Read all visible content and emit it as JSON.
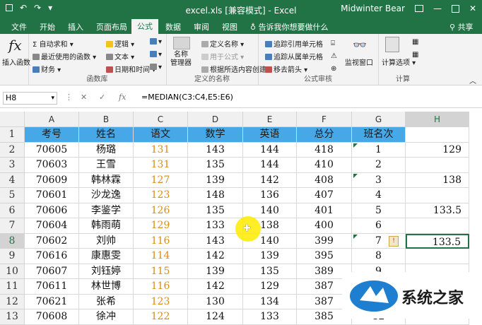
{
  "titlebar": {
    "filename": "excel.xls",
    "mode": "[兼容模式]",
    "sep": "-",
    "app": "Excel",
    "user": "Midwinter Bear",
    "save_icon": "save-icon",
    "undo_icon": "undo-icon",
    "redo_icon": "redo-icon",
    "minimize_icon": "minimize-icon",
    "maximize_icon": "maximize-icon",
    "close_icon": "close-icon"
  },
  "tabs": [
    "文件",
    "开始",
    "插入",
    "页面布局",
    "公式",
    "数据",
    "审阅",
    "视图"
  ],
  "tell_me": "告诉我你想要做什么",
  "share": "共享",
  "ribbon": {
    "insert_function": "插入函数",
    "lib": {
      "autosum": "自动求和",
      "recent": "最近使用的函数",
      "finance": "财务",
      "logic": "逻辑",
      "text": "文本",
      "datetime": "日期和时间"
    },
    "lib_caption": "函数库",
    "names": {
      "name_manager_1": "名称",
      "name_manager_2": "管理器",
      "define": "定义名称",
      "use": "用于公式",
      "create": "根据所选内容创建"
    },
    "names_caption": "定义的名称",
    "audit": {
      "trace_prec": "追踪引用单元格",
      "trace_dep": "追踪从属单元格",
      "remove": "移去箭头",
      "watch": "监视窗口"
    },
    "audit_caption": "公式审核",
    "calc": {
      "options": "计算选项"
    },
    "calc_caption": "计算"
  },
  "formula_bar": {
    "name_box": "H8",
    "fx": "fx",
    "formula": "=MEDIAN(C3:C4,E5:E6)"
  },
  "columns": [
    "A",
    "B",
    "C",
    "D",
    "E",
    "F",
    "G",
    "H"
  ],
  "rows": [
    "1",
    "2",
    "3",
    "4",
    "5",
    "6",
    "7",
    "8",
    "9",
    "10",
    "11",
    "12",
    "13"
  ],
  "table": {
    "header": [
      "考号",
      "姓名",
      "语文",
      "数学",
      "英语",
      "总分",
      "班名次"
    ],
    "data": [
      [
        "70605",
        "杨璐",
        "131",
        "143",
        "144",
        "418",
        "1",
        "129"
      ],
      [
        "70603",
        "王雪",
        "131",
        "135",
        "144",
        "410",
        "2",
        ""
      ],
      [
        "70609",
        "韩林霖",
        "127",
        "139",
        "142",
        "408",
        "3",
        "138"
      ],
      [
        "70601",
        "沙龙逸",
        "123",
        "148",
        "136",
        "407",
        "4",
        ""
      ],
      [
        "70606",
        "李鉴学",
        "126",
        "135",
        "140",
        "401",
        "5",
        "133.5"
      ],
      [
        "70604",
        "韩雨萌",
        "129",
        "133",
        "138",
        "400",
        "6",
        ""
      ],
      [
        "70602",
        "刘帅",
        "116",
        "143",
        "140",
        "399",
        "7",
        "133.5"
      ],
      [
        "70616",
        "康惠雯",
        "114",
        "142",
        "139",
        "395",
        "8",
        ""
      ],
      [
        "70607",
        "刘钰婷",
        "115",
        "139",
        "135",
        "389",
        "9",
        ""
      ],
      [
        "70611",
        "林世博",
        "116",
        "142",
        "129",
        "387",
        "10",
        ""
      ],
      [
        "70621",
        "张希",
        "123",
        "130",
        "134",
        "387",
        "11",
        ""
      ],
      [
        "70608",
        "徐冲",
        "122",
        "124",
        "133",
        "385",
        "12",
        ""
      ]
    ]
  }
}
